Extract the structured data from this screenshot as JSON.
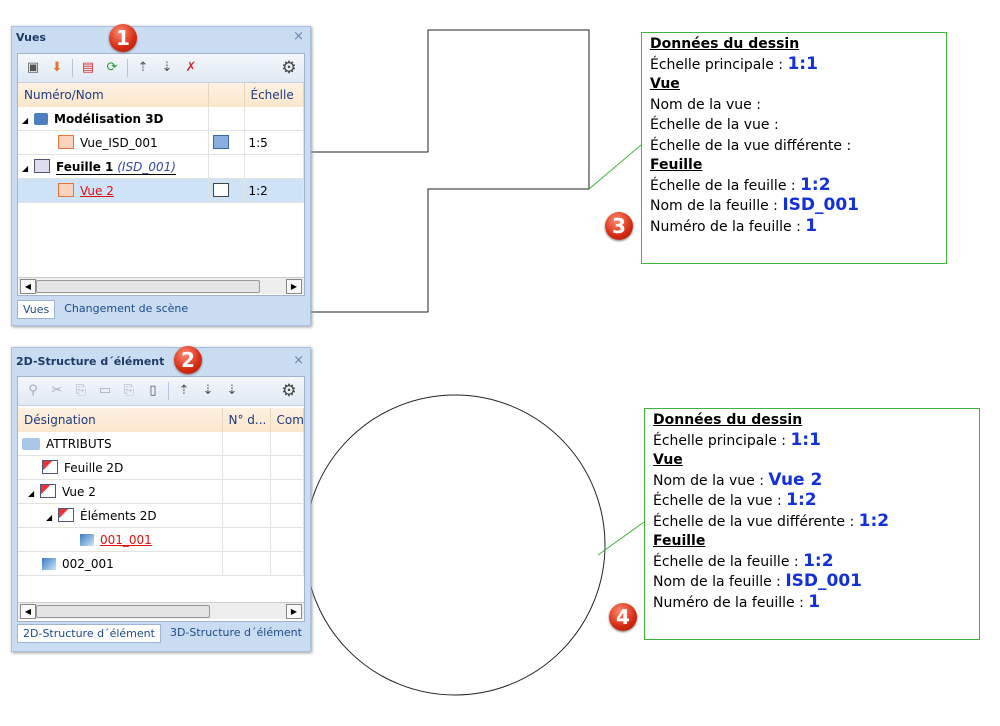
{
  "panel_vues": {
    "title": "Vues",
    "badge": "1",
    "columns": [
      "Numéro/Nom",
      "",
      "Échelle"
    ],
    "rows": [
      {
        "name": "Modélisation 3D",
        "scale": ""
      },
      {
        "name": "Vue_ISD_001",
        "scale": "1:5"
      },
      {
        "name": "Feuille 1",
        "suffix": "(ISD_001)",
        "scale": ""
      },
      {
        "name": "Vue 2",
        "scale": "1:2"
      }
    ],
    "tabs": [
      "Vues",
      "Changement de scène"
    ]
  },
  "panel_structure": {
    "title": "2D-Structure d´élément",
    "badge": "2",
    "columns": [
      "Désignation",
      "N° d...",
      "Com"
    ],
    "rows": [
      {
        "name": "ATTRIBUTS"
      },
      {
        "name": "Feuille 2D"
      },
      {
        "name": "Vue 2"
      },
      {
        "name": "Éléments 2D"
      },
      {
        "name": "001_001"
      },
      {
        "name": "002_001"
      }
    ],
    "tabs": [
      "2D-Structure d´élément",
      "3D-Structure d´élément"
    ]
  },
  "box3": {
    "badge": "3",
    "lines": [
      {
        "label": "Données du dessin",
        "header": true
      },
      {
        "label": "Échelle principale : ",
        "value": "1:1"
      },
      {
        "label": "Vue",
        "header": true
      },
      {
        "label": "Nom de la vue : ",
        "value": ""
      },
      {
        "label": "Échelle de la vue : ",
        "value": ""
      },
      {
        "label": "Échelle de la vue différente : ",
        "value": ""
      },
      {
        "label": "Feuille",
        "header": true
      },
      {
        "label": "Échelle de la feuille : ",
        "value": "1:2"
      },
      {
        "label": "Nom de la feuille : ",
        "value": "ISD_001"
      },
      {
        "label": "Numéro de la feuille : ",
        "value": "1"
      }
    ]
  },
  "box4": {
    "badge": "4",
    "lines": [
      {
        "label": "Données du dessin",
        "header": true
      },
      {
        "label": "Échelle principale : ",
        "value": "1:1"
      },
      {
        "label": "Vue",
        "header": true
      },
      {
        "label": "Nom de la vue : ",
        "value": "Vue 2"
      },
      {
        "label": "Échelle de la vue : ",
        "value": "1:2"
      },
      {
        "label": "Échelle de la vue différente : ",
        "value": "1:2"
      },
      {
        "label": "Feuille",
        "header": true
      },
      {
        "label": "Échelle de la feuille : ",
        "value": "1:2"
      },
      {
        "label": "Nom de la feuille : ",
        "value": "ISD_001"
      },
      {
        "label": "Numéro de la feuille : ",
        "value": "1"
      }
    ]
  }
}
